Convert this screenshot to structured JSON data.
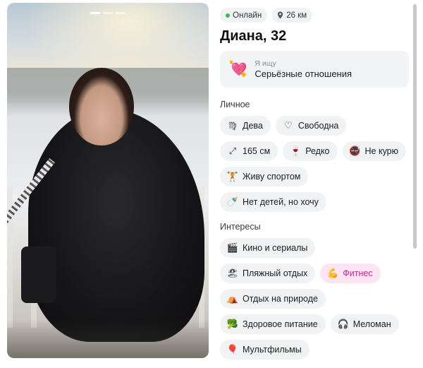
{
  "status": {
    "online_label": "Онлайн",
    "distance": "26 км"
  },
  "profile": {
    "name_age": "Диана, 32"
  },
  "seeking": {
    "icon": "heart-with-arrow-icon",
    "label": "Я ищу",
    "value": "Серьёзные отношения"
  },
  "personal": {
    "title": "Личное",
    "items": [
      {
        "icon": "virgo-icon",
        "glyph": "♍",
        "label": "Дева"
      },
      {
        "icon": "heart-outline-icon",
        "glyph": "♡",
        "label": "Свободна"
      },
      {
        "icon": "height-arrows-icon",
        "glyph": "⤢",
        "label": "165 см"
      },
      {
        "icon": "wine-glass-icon",
        "glyph": "🍷",
        "label": "Редко"
      },
      {
        "icon": "no-smoking-icon",
        "glyph": "🚭",
        "label": "Не курю"
      },
      {
        "icon": "dumbbell-icon",
        "glyph": "🏋",
        "label": "Живу спортом"
      },
      {
        "icon": "baby-bottle-icon",
        "glyph": "🍼",
        "label": "Нет детей, но хочу"
      }
    ]
  },
  "interests": {
    "title": "Интересы",
    "items": [
      {
        "icon": "clapperboard-icon",
        "glyph": "🎬",
        "label": "Кино и сериалы",
        "highlight": false
      },
      {
        "icon": "beach-umbrella-icon",
        "glyph": "🏖",
        "label": "Пляжный отдых",
        "highlight": false
      },
      {
        "icon": "flexed-biceps-icon",
        "glyph": "💪",
        "label": "Фитнес",
        "highlight": true
      },
      {
        "icon": "camping-tent-icon",
        "glyph": "⛺",
        "label": "Отдых на природе",
        "highlight": false
      },
      {
        "icon": "broccoli-icon",
        "glyph": "🥦",
        "label": "Здоровое питание",
        "highlight": false
      },
      {
        "icon": "headphones-icon",
        "glyph": "🎧",
        "label": "Меломан",
        "highlight": false
      },
      {
        "icon": "balloon-icon",
        "glyph": "🎈",
        "label": "Мультфильмы",
        "highlight": false
      }
    ]
  },
  "photo": {
    "count": 3,
    "active_index": 0
  },
  "colors": {
    "online": "#2fbf4f",
    "chip_bg": "#f1f2f4",
    "highlight_bg": "#fde4f3",
    "highlight_text": "#c2278f"
  }
}
